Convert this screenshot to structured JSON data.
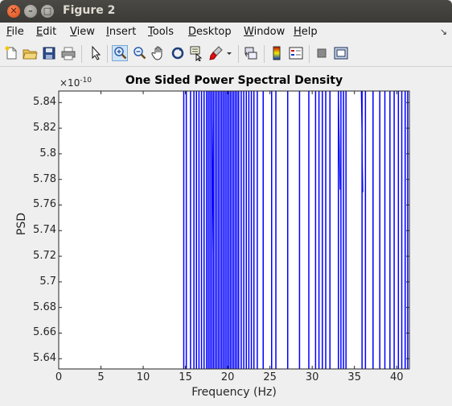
{
  "window": {
    "title": "Figure 2"
  },
  "menu": [
    {
      "label": "File",
      "key": "F",
      "rest": "ile"
    },
    {
      "label": "Edit",
      "key": "E",
      "rest": "dit"
    },
    {
      "label": "View",
      "key": "V",
      "rest": "iew"
    },
    {
      "label": "Insert",
      "key": "I",
      "rest": "nsert"
    },
    {
      "label": "Tools",
      "key": "T",
      "rest": "ools"
    },
    {
      "label": "Desktop",
      "key": "D",
      "rest": "esktop"
    },
    {
      "label": "Window",
      "key": "W",
      "rest": "indow"
    },
    {
      "label": "Help",
      "key": "H",
      "rest": "elp"
    }
  ],
  "toolbar": [
    "new-figure-icon",
    "open-file-icon",
    "save-icon",
    "print-icon",
    "pointer-icon",
    "zoom-in-icon",
    "zoom-out-icon",
    "pan-icon",
    "rotate-3d-icon",
    "data-cursor-icon",
    "brush-icon",
    "link-plot-icon",
    "colorbar-icon",
    "legend-icon",
    "hide-plot-tools-icon",
    "show-plot-tools-icon"
  ],
  "plot": {
    "exponent_base": "×10",
    "exponent_power": "-10"
  },
  "chart_data": {
    "type": "line",
    "title": "One Sided Power Spectral Density",
    "xlabel": "Frequency (Hz)",
    "ylabel": "PSD",
    "xlim": [
      0,
      41.5
    ],
    "ylim": [
      5.632,
      5.849
    ],
    "y_scale_note": "×10^-10",
    "xticks": [
      0,
      5,
      10,
      15,
      20,
      25,
      30,
      35,
      40
    ],
    "yticks": [
      "5.64",
      "5.66",
      "5.68",
      "5.7",
      "5.72",
      "5.74",
      "5.76",
      "5.78",
      "5.8",
      "5.82",
      "5.84"
    ],
    "ytick_values": [
      5.64,
      5.66,
      5.68,
      5.7,
      5.72,
      5.74,
      5.76,
      5.78,
      5.8,
      5.82,
      5.84
    ],
    "grid": false,
    "series": [
      {
        "color": "#0000ff",
        "spike_frequencies": [
          14.8,
          15.1,
          15.6,
          16.0,
          16.3,
          16.6,
          16.9,
          17.2,
          17.5,
          17.7,
          17.9,
          18.1,
          18.3,
          18.5,
          18.7,
          18.9,
          19.1,
          19.3,
          19.5,
          19.7,
          19.9,
          20.1,
          20.3,
          20.5,
          20.7,
          20.9,
          21.1,
          21.3,
          21.6,
          21.9,
          22.2,
          22.5,
          22.8,
          23.1,
          23.5,
          24.2,
          25.2,
          25.7,
          27.1,
          28.5,
          29.6,
          30.4,
          30.8,
          31.2,
          31.6,
          32.1,
          33.1,
          33.4,
          33.7,
          34.0,
          35.9,
          36.3,
          37.2,
          38.0,
          38.6,
          39.2,
          39.7,
          40.2,
          40.6,
          41.0,
          41.3
        ],
        "spike_floor": 5.632,
        "spike_top": 5.849,
        "notch_frequencies": [
          18.2,
          33.2,
          35.9
        ],
        "notch_values": [
          5.706,
          5.772,
          5.77
        ]
      }
    ]
  }
}
